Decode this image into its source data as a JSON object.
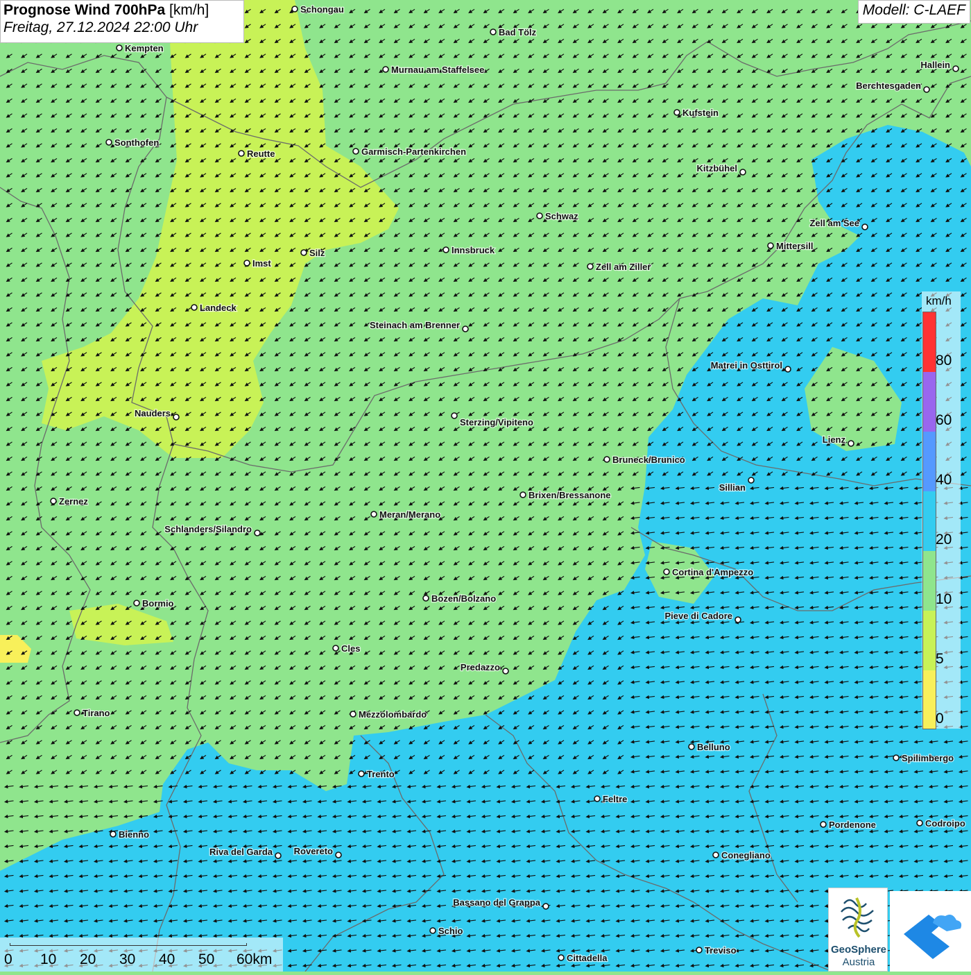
{
  "header": {
    "title_bold": "Prognose Wind 700hPa",
    "title_unit": "[km/h]",
    "subtitle": "Freitag, 27.12.2024 22:00 Uhr",
    "model": "Modell: C-LAEF"
  },
  "legend": {
    "unit": "km/h",
    "ticks": [
      "80",
      "60",
      "40",
      "20",
      "10",
      "5",
      "0"
    ],
    "colors": [
      "#ff3333",
      "#9966ee",
      "#5599ff",
      "#33ccf0",
      "#8fe58d",
      "#c8f257",
      "#f8f05a"
    ]
  },
  "scale": {
    "ticks": [
      "0",
      "10",
      "20",
      "30",
      "40",
      "50",
      "60km"
    ]
  },
  "logos": {
    "geosphere_name": "GeoSphere",
    "geosphere_sub": "Austria"
  },
  "cities": [
    {
      "name": "Schongau"
    },
    {
      "name": "Bad Tölz"
    },
    {
      "name": "Kempten"
    },
    {
      "name": "Murnau am Staffelsee"
    },
    {
      "name": "Hallein"
    },
    {
      "name": "Berchtesgaden"
    },
    {
      "name": "Kufstein"
    },
    {
      "name": "Sonthofen"
    },
    {
      "name": "Reutte"
    },
    {
      "name": "Garmisch-Partenkirchen"
    },
    {
      "name": "Kitzbühel"
    },
    {
      "name": "Schwaz"
    },
    {
      "name": "Zell am See"
    },
    {
      "name": "Mittersill"
    },
    {
      "name": "Innsbruck"
    },
    {
      "name": "Silz"
    },
    {
      "name": "Imst"
    },
    {
      "name": "Zell am Ziller"
    },
    {
      "name": "Landeck"
    },
    {
      "name": "Steinach am Brenner"
    },
    {
      "name": "Matrei in Osttirol"
    },
    {
      "name": "Nauders"
    },
    {
      "name": "Sterzing/Vipiteno"
    },
    {
      "name": "Lienz"
    },
    {
      "name": "Bruneck/Brunico"
    },
    {
      "name": "Sillian"
    },
    {
      "name": "Zernez"
    },
    {
      "name": "Brixen/Bressanone"
    },
    {
      "name": "Meran/Merano"
    },
    {
      "name": "Schlanders/Silandro"
    },
    {
      "name": "Cortina d'Ampezzo"
    },
    {
      "name": "Bormio"
    },
    {
      "name": "Bozen/Bolzano"
    },
    {
      "name": "Pieve di Cadore"
    },
    {
      "name": "Cles"
    },
    {
      "name": "Predazzo"
    },
    {
      "name": "Tirano"
    },
    {
      "name": "Mezzolombardo"
    },
    {
      "name": "Belluno"
    },
    {
      "name": "Spilimbergo"
    },
    {
      "name": "Trento"
    },
    {
      "name": "Feltre"
    },
    {
      "name": "Pordenone"
    },
    {
      "name": "Codroipo"
    },
    {
      "name": "Bienno"
    },
    {
      "name": "Riva del Garda"
    },
    {
      "name": "Rovereto"
    },
    {
      "name": "Conegliano"
    },
    {
      "name": "Bassano del Grappa"
    },
    {
      "name": "Schio"
    },
    {
      "name": "Treviso"
    },
    {
      "name": "Cittadella"
    }
  ]
}
